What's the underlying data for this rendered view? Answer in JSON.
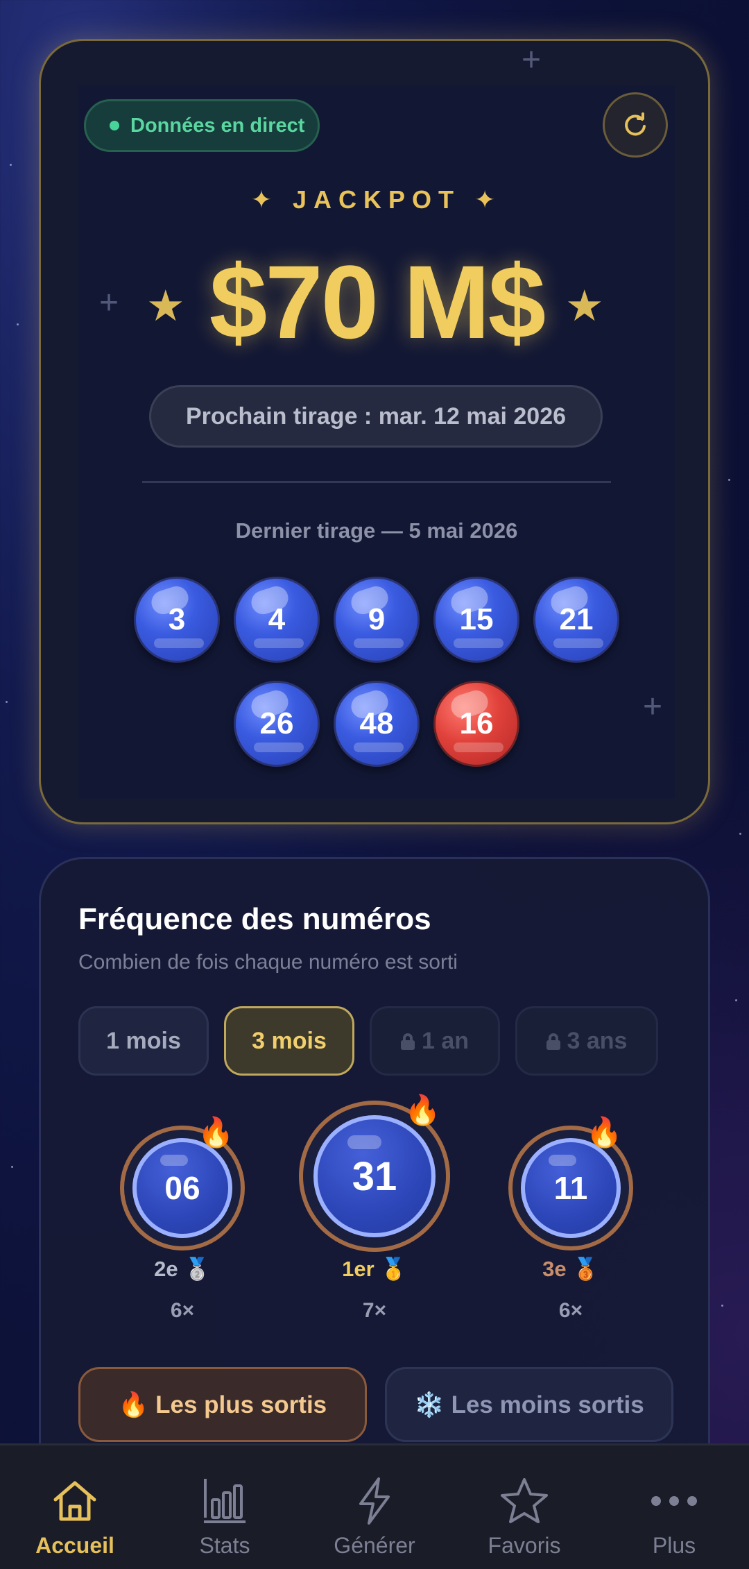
{
  "live_badge": {
    "text": "Données en direct"
  },
  "jackpot": {
    "label": "✦ JACKPOT ✦",
    "amount": "$70 M$",
    "next_draw": "Prochain tirage : mar. 12 mai 2026",
    "last_draw_label": "Dernier tirage — 5 mai 2026",
    "numbers": [
      "3",
      "4",
      "9",
      "15",
      "21",
      "26",
      "48"
    ],
    "bonus": "16"
  },
  "frequency": {
    "title": "Fréquence des numéros",
    "subtitle": "Combien de fois chaque numéro est sorti",
    "periods": [
      {
        "label": "1 mois",
        "state": "normal"
      },
      {
        "label": "3 mois",
        "state": "active"
      },
      {
        "label": "1 an",
        "state": "locked"
      },
      {
        "label": "3 ans",
        "state": "locked"
      }
    ],
    "podium": [
      {
        "number": "06",
        "rank": "2e 🥈",
        "count": "6×"
      },
      {
        "number": "31",
        "rank": "1er 🥇",
        "count": "7×"
      },
      {
        "number": "11",
        "rank": "3e 🥉",
        "count": "6×"
      }
    ],
    "filters": {
      "hot": "🔥 Les plus sortis",
      "cold": "❄️ Les moins sortis"
    }
  },
  "nav": [
    {
      "label": "Accueil",
      "icon": "home-icon",
      "active": true
    },
    {
      "label": "Stats",
      "icon": "bar-chart-icon",
      "active": false
    },
    {
      "label": "Générer",
      "icon": "lightning-icon",
      "active": false
    },
    {
      "label": "Favoris",
      "icon": "star-icon",
      "active": false
    },
    {
      "label": "Plus",
      "icon": "more-dots-icon",
      "active": false
    }
  ],
  "colors": {
    "accent_gold": "#e9c35a",
    "live_green": "#5ad6a0",
    "ball_blue": "#3a5be0",
    "ball_red": "#e0413a"
  }
}
